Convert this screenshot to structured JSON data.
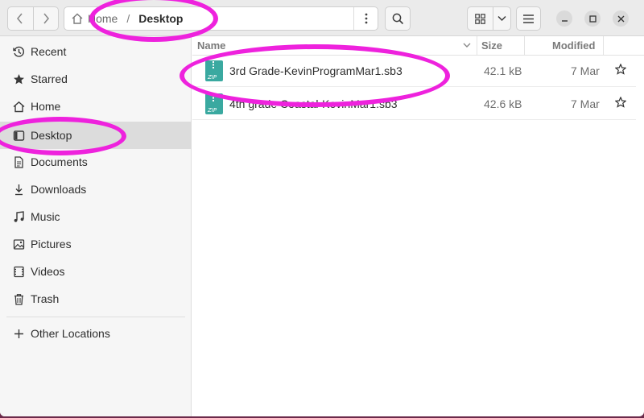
{
  "header": {
    "path_home": "Home",
    "path_separator": "/",
    "path_current": "Desktop"
  },
  "sidebar": {
    "items": [
      {
        "label": "Recent",
        "icon": "clock-icon"
      },
      {
        "label": "Starred",
        "icon": "star-icon"
      },
      {
        "label": "Home",
        "icon": "home-icon"
      },
      {
        "label": "Desktop",
        "icon": "desktop-icon"
      },
      {
        "label": "Documents",
        "icon": "document-icon"
      },
      {
        "label": "Downloads",
        "icon": "download-icon"
      },
      {
        "label": "Music",
        "icon": "music-icon"
      },
      {
        "label": "Pictures",
        "icon": "picture-icon"
      },
      {
        "label": "Videos",
        "icon": "video-icon"
      },
      {
        "label": "Trash",
        "icon": "trash-icon"
      }
    ],
    "other_locations": "Other Locations"
  },
  "columns": {
    "name": "Name",
    "size": "Size",
    "modified": "Modified"
  },
  "files": [
    {
      "name": "3rd Grade-KevinProgramMar1.sb3",
      "size": "42.1 kB",
      "modified": "7 Mar",
      "icon": "zip-archive-icon"
    },
    {
      "name": "4th grade Coastal-KevinMar1.sb3",
      "size": "42.6 kB",
      "modified": "7 Mar",
      "icon": "zip-archive-icon"
    }
  ],
  "colors": {
    "annotation": "#ee22dd",
    "zip_icon": "#3aa9a0",
    "sidebar_active": "#dcdcdc"
  }
}
